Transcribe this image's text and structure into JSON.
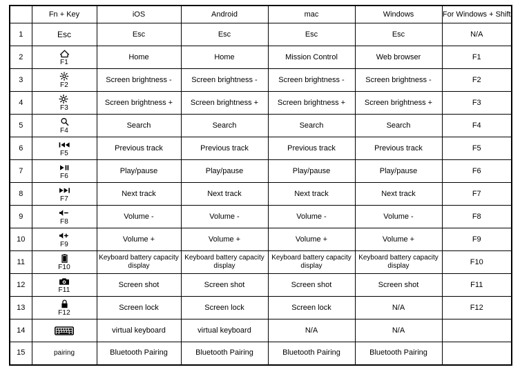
{
  "table": {
    "headers": [
      "",
      "Fn + Key",
      "iOS",
      "Android",
      "mac",
      "Windows",
      "For Windows + Shift"
    ],
    "rows": [
      {
        "num": "1",
        "key": {
          "glyph": "none",
          "label": "Esc",
          "fn": ""
        },
        "ios": "Esc",
        "android": "Esc",
        "mac": "Esc",
        "windows": "Esc",
        "shift": "N/A"
      },
      {
        "num": "2",
        "key": {
          "glyph": "home-icon",
          "label": "",
          "fn": "F1"
        },
        "ios": "Home",
        "android": "Home",
        "mac": "Mission Control",
        "windows": "Web browser",
        "shift": "F1"
      },
      {
        "num": "3",
        "key": {
          "glyph": "brightness-down-icon",
          "label": "",
          "fn": "F2"
        },
        "ios": "Screen brightness -",
        "android": "Screen brightness -",
        "mac": "Screen brightness -",
        "windows": "Screen brightness -",
        "shift": "F2"
      },
      {
        "num": "4",
        "key": {
          "glyph": "brightness-up-icon",
          "label": "",
          "fn": "F3"
        },
        "ios": "Screen brightness +",
        "android": "Screen brightness +",
        "mac": "Screen brightness +",
        "windows": "Screen brightness +",
        "shift": "F3"
      },
      {
        "num": "5",
        "key": {
          "glyph": "search-icon",
          "label": "",
          "fn": "F4"
        },
        "ios": "Search",
        "android": "Search",
        "mac": "Search",
        "windows": "Search",
        "shift": "F4"
      },
      {
        "num": "6",
        "key": {
          "glyph": "previous-track-icon",
          "label": "",
          "fn": "F5"
        },
        "ios": "Previous track",
        "android": "Previous track",
        "mac": "Previous track",
        "windows": "Previous track",
        "shift": "F5"
      },
      {
        "num": "7",
        "key": {
          "glyph": "play-pause-icon",
          "label": "",
          "fn": "F6"
        },
        "ios": "Play/pause",
        "android": "Play/pause",
        "mac": "Play/pause",
        "windows": "Play/pause",
        "shift": "F6"
      },
      {
        "num": "8",
        "key": {
          "glyph": "next-track-icon",
          "label": "",
          "fn": "F7"
        },
        "ios": "Next track",
        "android": "Next track",
        "mac": "Next track",
        "windows": "Next track",
        "shift": "F7"
      },
      {
        "num": "9",
        "key": {
          "glyph": "volume-down-icon",
          "label": "",
          "fn": "F8"
        },
        "ios": "Volume -",
        "android": "Volume -",
        "mac": "Volume -",
        "windows": "Volume -",
        "shift": "F8"
      },
      {
        "num": "10",
        "key": {
          "glyph": "volume-up-icon",
          "label": "",
          "fn": "F9"
        },
        "ios": "Volume +",
        "android": "Volume +",
        "mac": "Volume +",
        "windows": "Volume +",
        "shift": "F9"
      },
      {
        "num": "11",
        "key": {
          "glyph": "battery-icon",
          "label": "",
          "fn": "F10"
        },
        "ios": "Keyboard battery capacity display",
        "android": "Keyboard battery capacity display",
        "mac": "Keyboard battery capacity display",
        "windows": "Keyboard battery capacity display",
        "shift": "F10"
      },
      {
        "num": "12",
        "key": {
          "glyph": "screenshot-icon",
          "label": "",
          "fn": "F11"
        },
        "ios": "Screen shot",
        "android": "Screen shot",
        "mac": "Screen shot",
        "windows": "Screen shot",
        "shift": "F11"
      },
      {
        "num": "13",
        "key": {
          "glyph": "lock-icon",
          "label": "",
          "fn": "F12"
        },
        "ios": "Screen lock",
        "android": "Screen lock",
        "mac": "Screen lock",
        "windows": "N/A",
        "shift": "F12"
      },
      {
        "num": "14",
        "key": {
          "glyph": "virtual-keyboard-icon",
          "label": "",
          "fn": ""
        },
        "ios": "virtual keyboard",
        "android": "virtual keyboard",
        "mac": "N/A",
        "windows": "N/A",
        "shift": ""
      },
      {
        "num": "15",
        "key": {
          "glyph": "none",
          "label": "pairing",
          "fn": ""
        },
        "ios": "Bluetooth Pairing",
        "android": "Bluetooth Pairing",
        "mac": "Bluetooth Pairing",
        "windows": "Bluetooth Pairing",
        "shift": ""
      }
    ]
  }
}
